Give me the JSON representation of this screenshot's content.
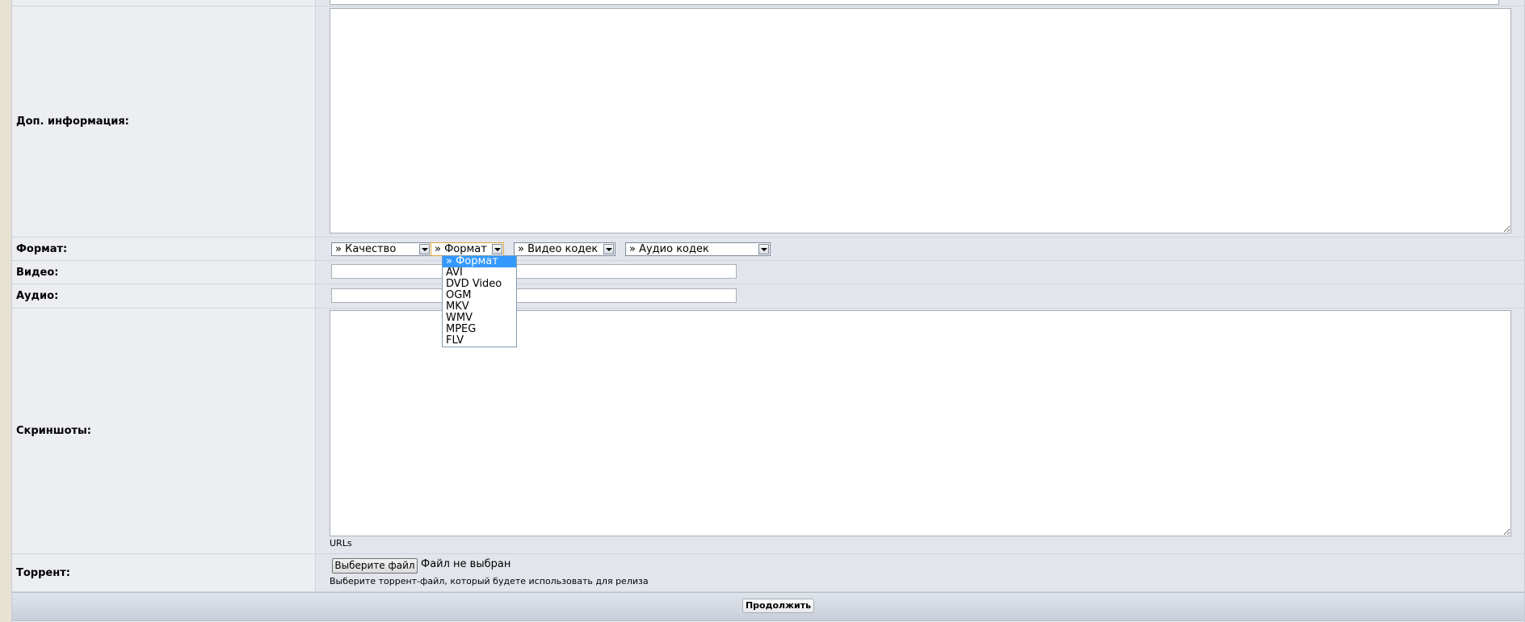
{
  "form": {
    "rows": {
      "additional_info": "Доп. информация:",
      "format": "Формат:",
      "video": "Видео:",
      "audio": "Аудио:",
      "screenshots": "Скриншоты:",
      "torrent": "Торрент:"
    },
    "selects": {
      "quality": "» Качество",
      "format": "» Формат",
      "video_codec": "» Видео кодек",
      "audio_codec": "» Аудио кодек"
    },
    "format_options": [
      "» Формат",
      "AVI",
      "DVD Video",
      "OGM",
      "MKV",
      "WMV",
      "MPEG",
      "FLV"
    ],
    "format_selected_index": 0,
    "screenshots_hint": "URLs",
    "file_button": "Выберите файл",
    "file_status": "Файл не выбран",
    "torrent_hint": "Выберите торрент-файл, который будете использовать для релиза",
    "submit": "Продолжить"
  },
  "colors": {
    "page_bg": "#e8e2d2",
    "label_bg": "#eceef2",
    "value_bg": "#e2e6ec",
    "highlight": "#3399ff"
  }
}
